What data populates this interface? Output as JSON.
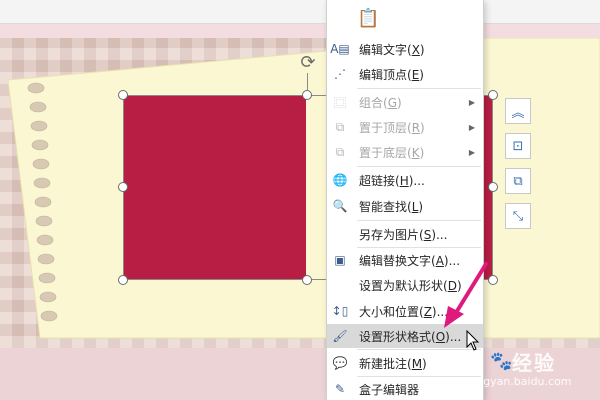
{
  "context_menu": {
    "items": [
      {
        "label": "编辑文字(",
        "key": "X",
        "icon": "edit-text-icon",
        "disabled": false,
        "submenu": false
      },
      {
        "label": "编辑顶点(",
        "key": "E",
        "icon": "edit-points-icon",
        "disabled": false,
        "submenu": false
      },
      {
        "label": "组合(",
        "key": "G",
        "icon": "group-icon",
        "disabled": true,
        "submenu": true
      },
      {
        "label": "置于顶层(",
        "key": "R",
        "icon": "bring-to-front-icon",
        "disabled": true,
        "submenu": true
      },
      {
        "label": "置于底层(",
        "key": "K",
        "icon": "send-to-back-icon",
        "disabled": true,
        "submenu": true
      },
      {
        "label": "超链接(",
        "key": "H",
        "suffix": ")...",
        "icon": "hyperlink-icon",
        "disabled": false,
        "submenu": false
      },
      {
        "label": "智能查找(",
        "key": "L",
        "icon": "smart-lookup-icon",
        "disabled": false,
        "submenu": false
      },
      {
        "label": "另存为图片(",
        "key": "S",
        "suffix": ")...",
        "icon": "",
        "disabled": false,
        "submenu": false
      },
      {
        "label": "编辑替换文字(",
        "key": "A",
        "suffix": ")...",
        "icon": "alt-text-icon",
        "disabled": false,
        "submenu": false
      },
      {
        "label": "设置为默认形状(",
        "key": "D",
        "icon": "",
        "disabled": false,
        "submenu": false
      },
      {
        "label": "大小和位置(",
        "key": "Z",
        "suffix": ")...",
        "icon": "size-position-icon",
        "disabled": false,
        "submenu": false
      },
      {
        "label": "设置形状格式(",
        "key": "O",
        "suffix": ")...",
        "icon": "format-shape-icon",
        "disabled": false,
        "submenu": false,
        "highlighted": true
      },
      {
        "label": "新建批注(",
        "key": "M",
        "icon": "new-comment-icon",
        "disabled": false,
        "submenu": false
      },
      {
        "label": "盒子编辑器",
        "key": "",
        "icon": "box-editor-icon",
        "disabled": false,
        "submenu": false
      }
    ]
  },
  "watermark": {
    "brand": "经验",
    "url": "jingyan.baidu.com"
  },
  "colors": {
    "shape_fill": "#b81e44",
    "menu_highlight": "#d9d9d9",
    "annotation_arrow": "#e0197d"
  }
}
